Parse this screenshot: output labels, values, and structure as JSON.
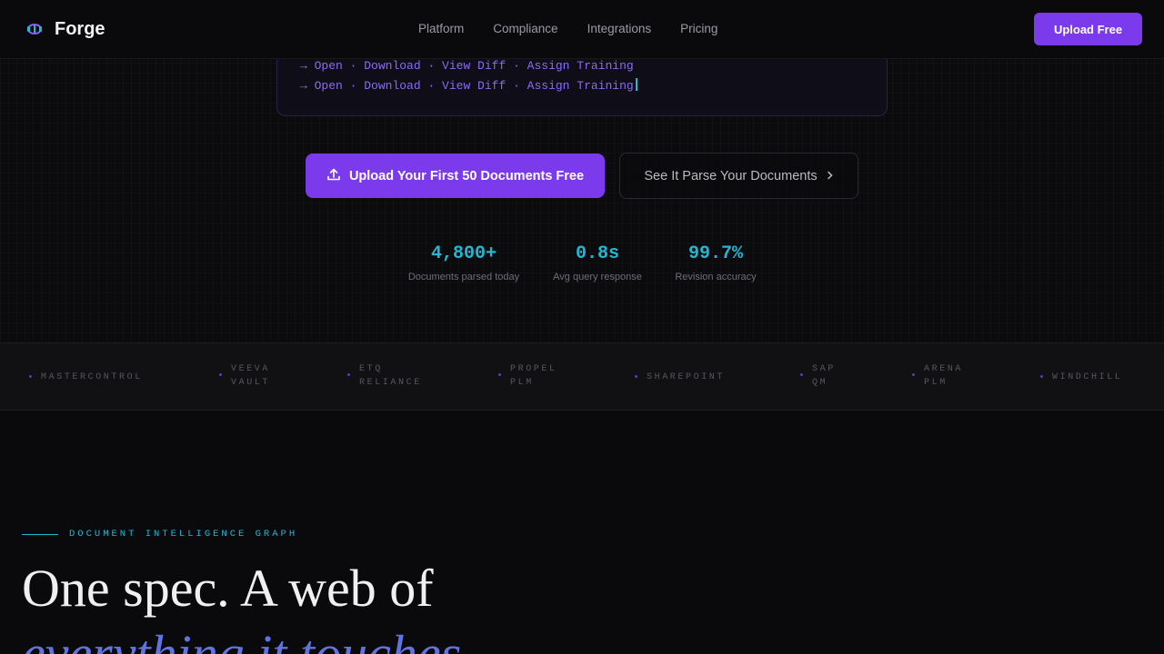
{
  "nav": {
    "brand": "Forge",
    "links": [
      "Platform",
      "Compliance",
      "Integrations",
      "Pricing"
    ],
    "cta": "Upload Free"
  },
  "terminal": {
    "arrow": "→",
    "lines": [
      "Open · Download · View Diff · Assign Training",
      "Open · Download · View Diff · Assign Training"
    ]
  },
  "hero": {
    "primary_cta": "Upload Your First 50 Documents Free",
    "secondary_cta": "See It Parse Your Documents"
  },
  "stats": [
    {
      "value": "4,800+",
      "label": "Documents parsed today"
    },
    {
      "value": "0.8s",
      "label": "Avg query response"
    },
    {
      "value": "99.7%",
      "label": "Revision accuracy"
    }
  ],
  "integrations": [
    [
      "MASTERCONTROL"
    ],
    [
      "VEEVA",
      "VAULT"
    ],
    [
      "ETQ",
      "RELIANCE"
    ],
    [
      "PROPEL",
      "PLM"
    ],
    [
      "SHAREPOINT"
    ],
    [
      "SAP",
      "QM"
    ],
    [
      "ARENA",
      "PLM"
    ],
    [
      "WINDCHILL"
    ]
  ],
  "section": {
    "eyebrow": "DOCUMENT INTELLIGENCE GRAPH",
    "headline": "One spec. A web of",
    "headline_em": "everything it touches"
  },
  "colors": {
    "accent": "#7c3aed",
    "cyan": "#22b8d4",
    "background": "#0a0a0d"
  }
}
